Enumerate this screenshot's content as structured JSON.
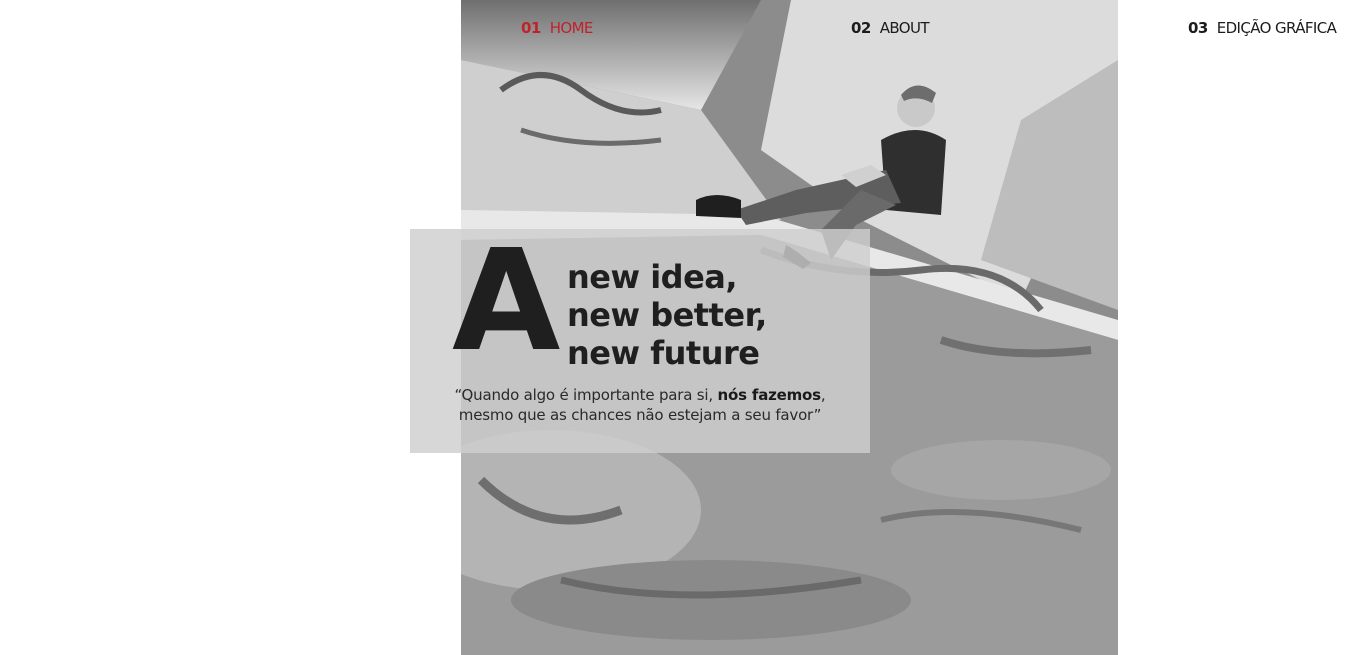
{
  "nav": {
    "items": [
      {
        "num": "01",
        "label": "HOME",
        "active": true
      },
      {
        "num": "02",
        "label": "ABOUT",
        "active": false
      },
      {
        "num": "03",
        "label": "EDIÇÃO GRÁFICA",
        "active": false
      }
    ],
    "colors": {
      "active": "#c0222c",
      "default": "#1c1c1c"
    }
  },
  "hero": {
    "initial": "A",
    "lines": [
      "new idea,",
      "new better,",
      "new future"
    ],
    "quote": {
      "open": "“Quando algo é importante para si, ",
      "emphasis": "nós fazemos",
      "line1_end": ",",
      "line2": "mesmo que as chances não estejam a seu favor”"
    },
    "image": "skater-sitting-on-graffiti-bowl-illustration"
  }
}
